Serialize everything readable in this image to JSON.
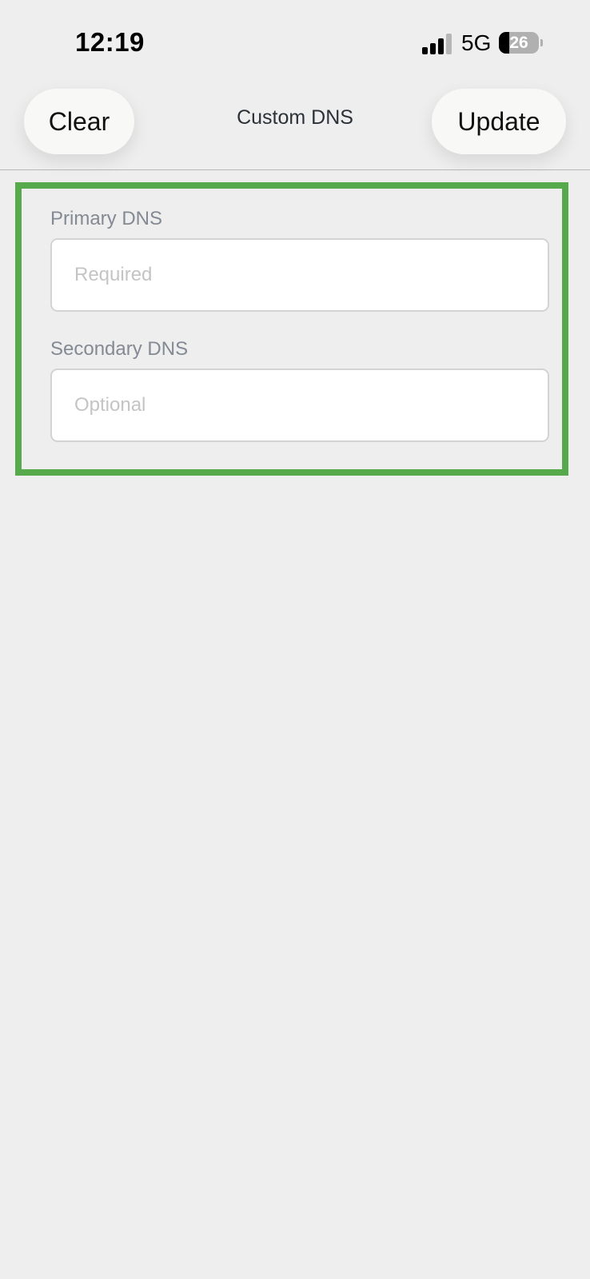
{
  "status_bar": {
    "time": "12:19",
    "network": "5G",
    "battery": "26"
  },
  "nav": {
    "clear_label": "Clear",
    "title": "Custom DNS",
    "update_label": "Update"
  },
  "form": {
    "primary": {
      "label": "Primary DNS",
      "value": "",
      "placeholder": "Required"
    },
    "secondary": {
      "label": "Secondary DNS",
      "value": "",
      "placeholder": "Optional"
    }
  },
  "colors": {
    "highlight_border": "#56aa4c",
    "background": "#eeeeee"
  }
}
